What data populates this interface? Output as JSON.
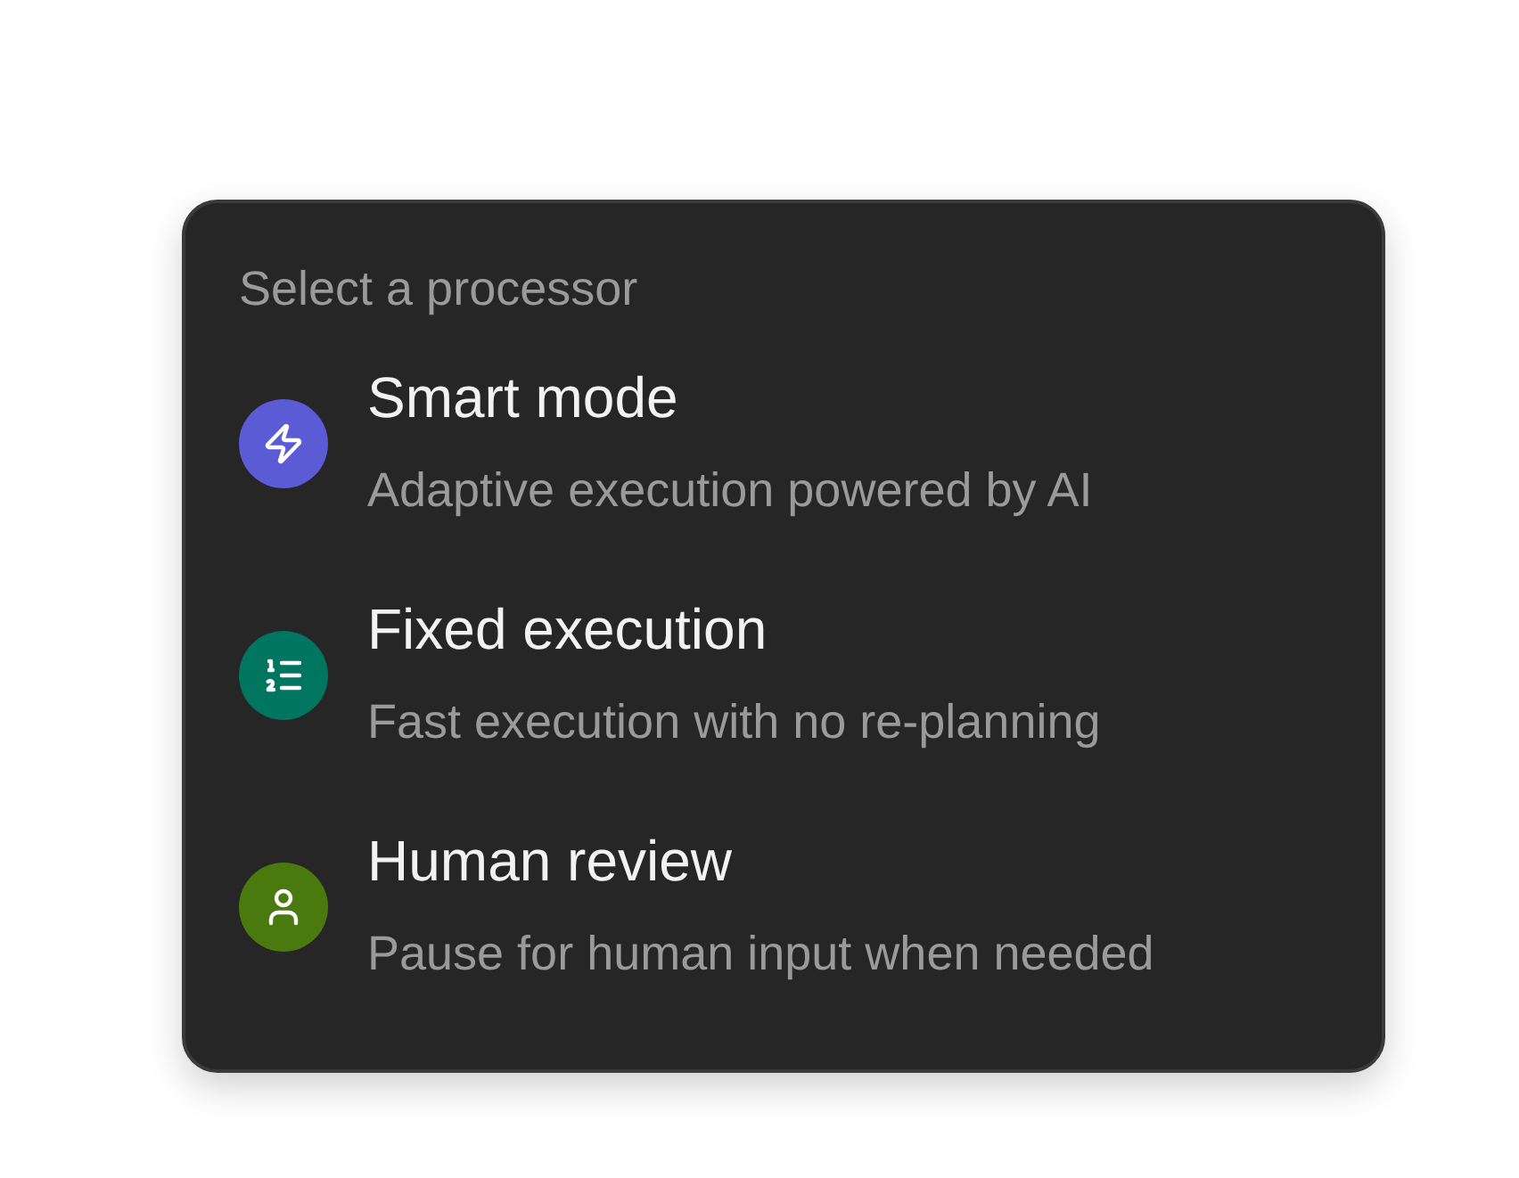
{
  "menu": {
    "heading": "Select a processor",
    "options": [
      {
        "kind": "bolt",
        "color": "#5b5bd6",
        "title": "Smart mode",
        "description": "Adaptive execution powered by AI"
      },
      {
        "kind": "list",
        "color": "#00755f",
        "title": "Fixed execution",
        "description": "Fast execution with no re-planning"
      },
      {
        "kind": "person",
        "color": "#4a7a0e",
        "title": "Human review",
        "description": "Pause for human input when needed"
      }
    ]
  }
}
